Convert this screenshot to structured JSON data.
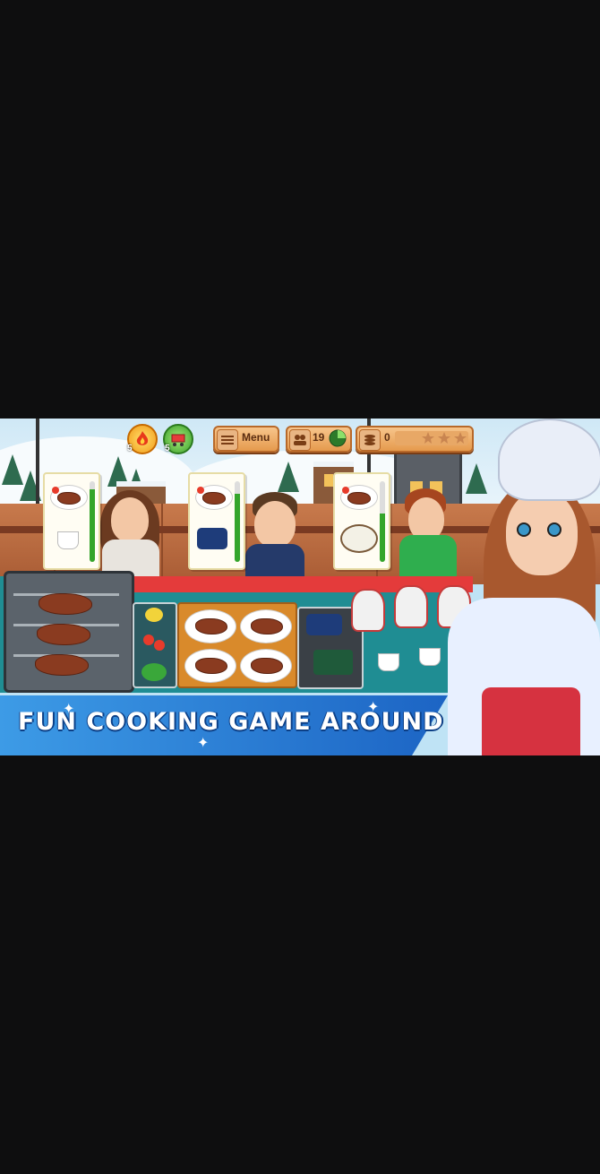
{
  "hud": {
    "fire_boost_count": "5",
    "shop_boost_count": "5",
    "menu_label": "Menu",
    "customers_count": "19",
    "coins_count": "0",
    "stars_total": 3
  },
  "tagline": "FUN COOKING GAME AROUND",
  "icons": {
    "fire": "fire-boost-icon",
    "shop": "shop-cart-icon",
    "menu": "list-icon",
    "customers": "people-icon",
    "coins": "coin-stack-icon",
    "timer": "pie-timer-icon",
    "star": "star-icon"
  },
  "orders": [
    {
      "customer": "woman-brown-hair",
      "items": [
        "steak-plate",
        "coffee-cup"
      ],
      "patience": 0.9
    },
    {
      "customer": "man-beard",
      "items": [
        "steak-plate",
        "blue-dish"
      ],
      "patience": 0.85
    },
    {
      "customer": "boy-red-hair",
      "items": [
        "steak-plate",
        "soup-bowl"
      ],
      "patience": 0.6
    }
  ],
  "colors": {
    "counter": "#1f8d93",
    "counter_top": "#e43b3b",
    "tagline_band": "#3d9be6",
    "hud_pill": "#f0ad66"
  }
}
